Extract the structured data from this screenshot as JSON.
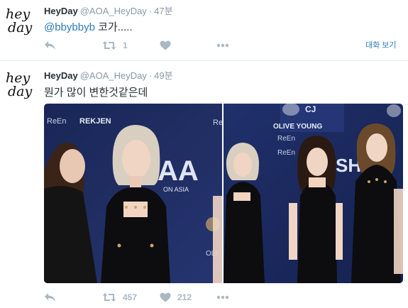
{
  "tweets": [
    {
      "avatar": {
        "line1": "hey",
        "line2": "day"
      },
      "name": "HeyDay",
      "handle": "@AOA_HeyDay",
      "sep": "·",
      "time": "47분",
      "mention": "@bbybbyb",
      "text": " 코가.....",
      "retweet_count": "1",
      "like_count": "",
      "view_conversation": "대화 보기"
    },
    {
      "avatar": {
        "line1": "hey",
        "line2": "day"
      },
      "name": "HeyDay",
      "handle": "@AOA_HeyDay",
      "sep": "·",
      "time": "49분",
      "text": "뭔가 많이 변한것같은데",
      "retweet_count": "457",
      "like_count": "212",
      "photos": [
        {
          "backdrop_text": [
            "ReEn",
            "REKJEN",
            "ReEn",
            "AA",
            "ON ASIA",
            "OLI"
          ]
        },
        {
          "backdrop_text": [
            "CJ",
            "OLIVE YOUNG",
            "ReEn",
            "ReEn",
            "SH"
          ]
        }
      ]
    }
  ],
  "colors": {
    "accent": "#2b7bb9",
    "muted": "#8899a6",
    "icon": "#aab8c2",
    "text": "#292f33",
    "border": "#e1e8ed"
  }
}
